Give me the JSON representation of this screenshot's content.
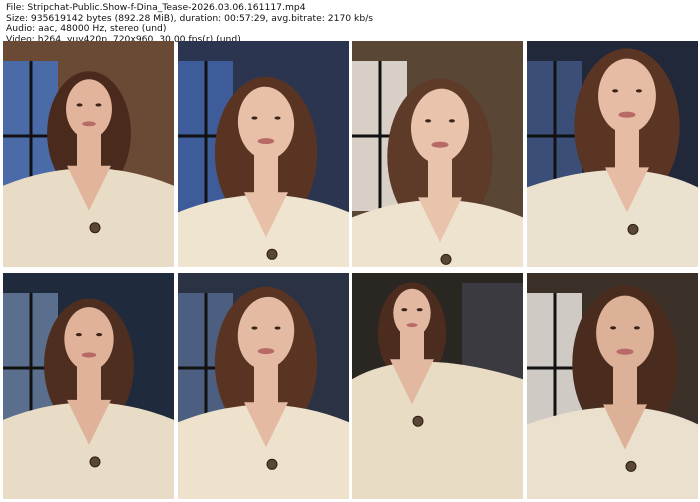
{
  "header": {
    "file_line": "File: Stripchat-Public.Show-f-Dina_Tease-2026.03.06.161117.mp4",
    "size_line": "Size: 935619142 bytes (892.28 MiB), duration: 00:57:29, avg.bitrate: 2170 kb/s",
    "audio_line": "Audio: aac, 48000 Hz, stereo (und)",
    "video_line": "Video: h264, yuv420p, 720x960, 30.00 fps(r) (und)"
  },
  "thumbnails": [
    {
      "name": "thumbnail-1",
      "bg": "#6b4a35",
      "window": "#4a6aa8",
      "sweater": "#e8dcc6",
      "hair": "#4a2a1c",
      "skin": "#e2b49c"
    },
    {
      "name": "thumbnail-2",
      "bg": "#2c3550",
      "window": "#3f5c9a",
      "sweater": "#efe4d0",
      "hair": "#5a3423",
      "skin": "#e8c0a8"
    },
    {
      "name": "thumbnail-3",
      "bg": "#5a4634",
      "window": "#d8cfc6",
      "sweater": "#eee3cf",
      "hair": "#5e3a28",
      "skin": "#e9c3ac"
    },
    {
      "name": "thumbnail-4",
      "bg": "#20283a",
      "window": "#3a4e78",
      "sweater": "#ebe1cf",
      "hair": "#5a3524",
      "skin": "#e6bca4"
    },
    {
      "name": "thumbnail-5",
      "bg": "#1f2a3c",
      "window": "#5a6e8e",
      "sweater": "#e8dcc6",
      "hair": "#4e2e20",
      "skin": "#e0b29a"
    },
    {
      "name": "thumbnail-6",
      "bg": "#2a3244",
      "window": "#4d5f80",
      "sweater": "#eee2cc",
      "hair": "#5a3423",
      "skin": "#e4bba2"
    },
    {
      "name": "thumbnail-7",
      "bg": "#2a2622",
      "window": "#3b3a40",
      "sweater": "#e9dcc4",
      "hair": "#4c2c1e",
      "skin": "#e2b8a0"
    },
    {
      "name": "thumbnail-8",
      "bg": "#3a3028",
      "window": "#cfcac4",
      "sweater": "#eae0cd",
      "hair": "#4a2c1e",
      "skin": "#ddb098"
    }
  ]
}
